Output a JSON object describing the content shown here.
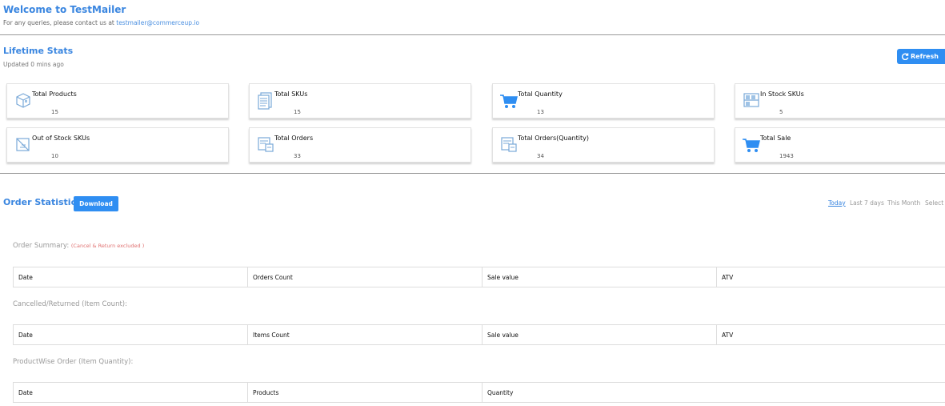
{
  "header": {
    "title": "Welcome to TestMailer",
    "contact_prefix": "For any queries, please contact us at",
    "contact_email": "testmailer@commerceup.io"
  },
  "lifetime": {
    "title": "Lifetime Stats",
    "updated": "Updated 0 mins ago",
    "refresh_label": "Refresh",
    "cards": [
      {
        "label": "Total Products",
        "value": "15",
        "icon": "box-icon"
      },
      {
        "label": "Total SKUs",
        "value": "15",
        "icon": "document-icon"
      },
      {
        "label": "Total Quantity",
        "value": "13",
        "icon": "cart-icon"
      },
      {
        "label": "In Stock SKUs",
        "value": "5",
        "icon": "shelf-icon"
      },
      {
        "label": "Out of Stock SKUs",
        "value": "10",
        "icon": "out-of-stock-icon"
      },
      {
        "label": "Total Orders",
        "value": "33",
        "icon": "orders-icon"
      },
      {
        "label": "Total Orders(Quantity)",
        "value": "34",
        "icon": "orders-icon"
      },
      {
        "label": "Total Sale",
        "value": "1943",
        "icon": "cart-icon"
      }
    ]
  },
  "orders": {
    "title": "Order Statistics:",
    "download_label": "Download",
    "ranges": [
      "Today",
      "Last 7 days",
      "This Month",
      "Select"
    ],
    "active_range": "Today",
    "summary": {
      "title": "Order Summary:",
      "note": "(Cancel & Return excluded )",
      "columns": [
        "Date",
        "Orders Count",
        "Sale value",
        "ATV"
      ]
    },
    "cancelled": {
      "title": "Cancelled/Returned (Item Count):",
      "columns": [
        "Date",
        "Items Count",
        "Sale value",
        "ATV"
      ]
    },
    "productwise": {
      "title": "ProductWise Order (Item Quantity):",
      "columns": [
        "Date",
        "Products",
        "Quantity"
      ]
    }
  },
  "colors": {
    "accent": "#3a86e0",
    "button": "#2f8ef2",
    "note": "#e07070"
  }
}
